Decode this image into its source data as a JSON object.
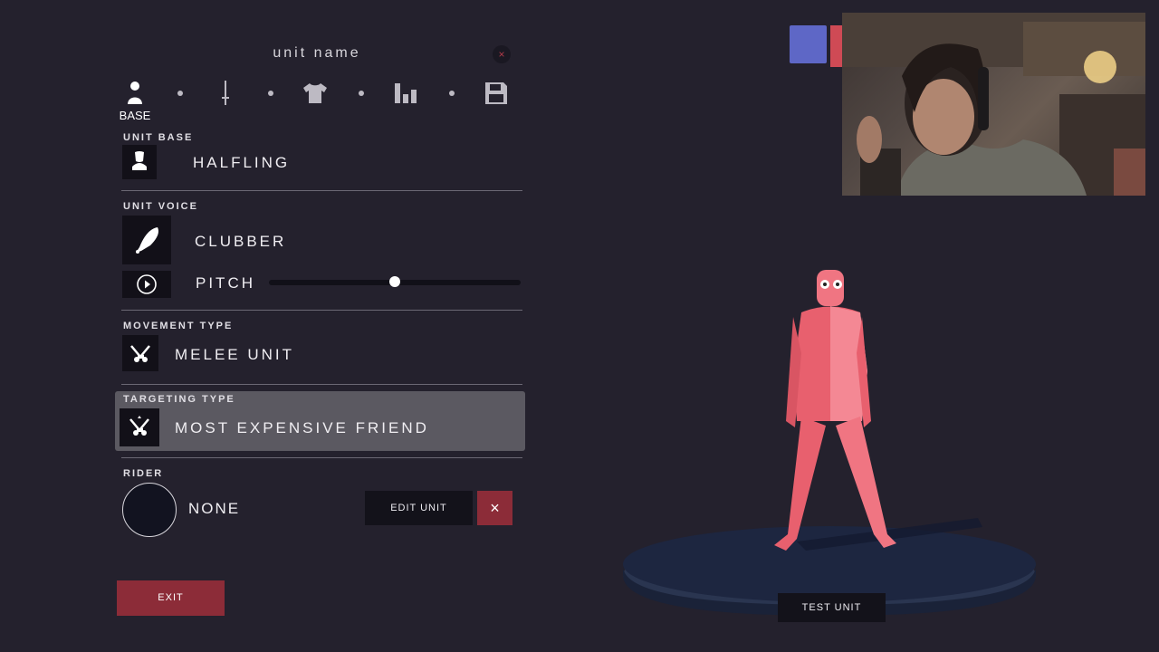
{
  "header": {
    "unit_name": "unit name",
    "close_symbol": "×"
  },
  "tabs": [
    {
      "icon": "person-icon",
      "label": "BASE",
      "active": true
    },
    {
      "icon": "sword-icon",
      "label": ""
    },
    {
      "icon": "shirt-icon",
      "label": ""
    },
    {
      "icon": "stats-icon",
      "label": ""
    },
    {
      "icon": "save-icon",
      "label": ""
    }
  ],
  "unit_base": {
    "label": "UNIT BASE",
    "value": "HALFLING",
    "icon": "halfling-icon"
  },
  "unit_voice": {
    "label": "UNIT VOICE",
    "value": "CLUBBER",
    "icon": "club-icon",
    "pitch_label": "PITCH",
    "pitch_level": 0.5
  },
  "movement": {
    "label": "MOVEMENT TYPE",
    "value": "MELEE UNIT",
    "icon": "melee-icon"
  },
  "targeting": {
    "label": "TARGETING TYPE",
    "value": "MOST EXPENSIVE FRIEND",
    "icon": "targeting-icon"
  },
  "rider": {
    "label": "RIDER",
    "value": "NONE",
    "edit_label": "EDIT UNIT",
    "remove_symbol": "×"
  },
  "buttons": {
    "exit": "EXIT",
    "test_unit": "TEST UNIT"
  },
  "colors": {
    "accent_red": "#8c2c38",
    "background": "#24212d",
    "unit_body": "#e8606e",
    "platform": "#1c2338",
    "blue_square": "#5e67c6"
  }
}
